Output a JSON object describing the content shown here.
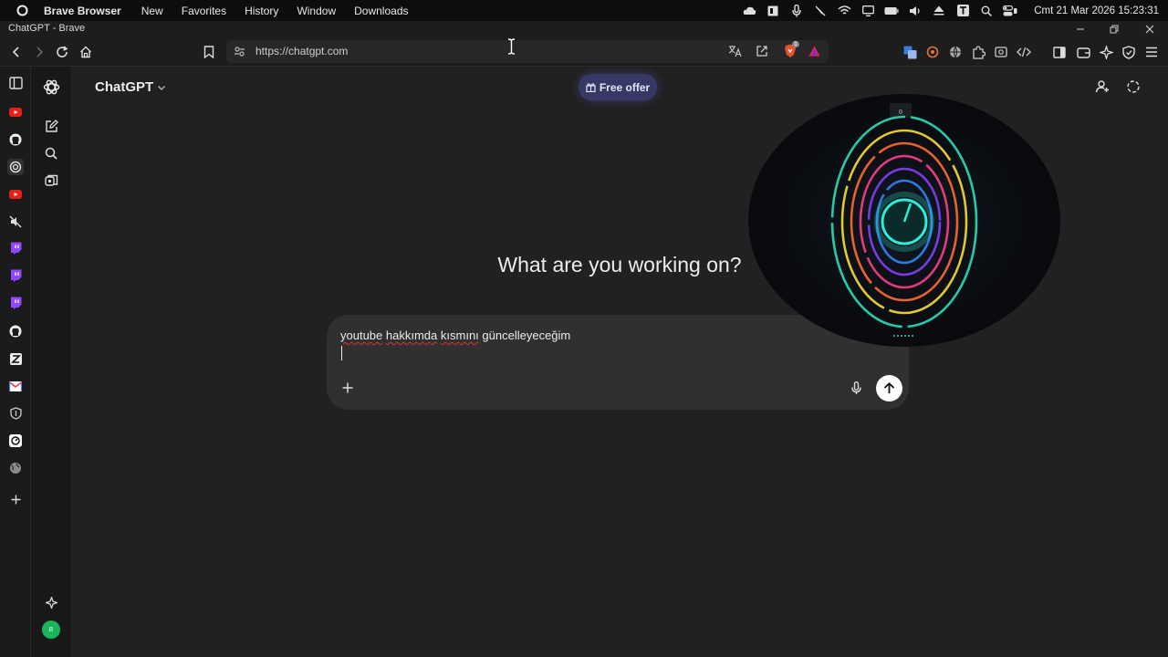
{
  "menubar": {
    "app_name": "Brave Browser",
    "menus": [
      "New",
      "Favorites",
      "History",
      "Window",
      "Downloads"
    ],
    "clock": "Cmt 21 Mar 2026 15:23:31"
  },
  "window": {
    "title": "ChatGPT - Brave"
  },
  "toolbar": {
    "url": "https://chatgpt.com",
    "brave_shield_count": "1"
  },
  "chat": {
    "model_label": "ChatGPT",
    "offer_label": "Free offer",
    "heading": "What are you working on?",
    "prompt_word1": "youtube",
    "prompt_word2": "hakkımda",
    "prompt_word3": "kısmını",
    "prompt_word4": "güncelleyeceğim",
    "avatar_initials": "B"
  },
  "video_overlay": {
    "counter": "0"
  },
  "colors": {
    "accent_offer": "#383866",
    "background": "#212121",
    "composer": "#303030"
  }
}
